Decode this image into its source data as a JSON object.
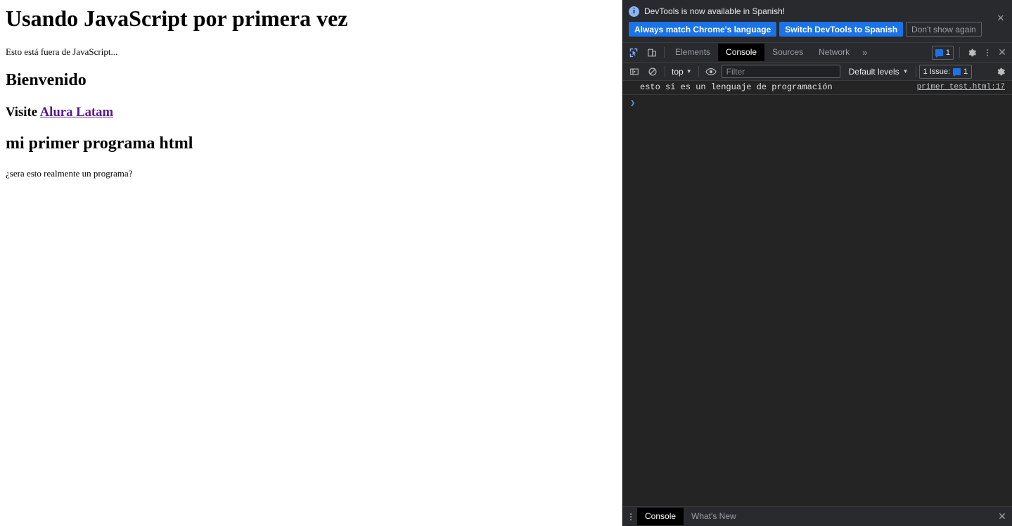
{
  "webpage": {
    "title_h1": "Usando JavaScript por primera vez",
    "paragraph_1": "Esto está fuera de JavaScript...",
    "heading_bienvenido": "Bienvenido",
    "visit_prefix": "Visite ",
    "link_label": "Alura Latam",
    "link_color": "#551a8b",
    "heading_programa": "mi primer programa html",
    "paragraph_2": "¿sera esto realmente un programa?"
  },
  "devtools": {
    "banner": {
      "info_icon": "info-icon",
      "message": "DevTools is now available in Spanish!",
      "primary_button_1": "Always match Chrome's language",
      "primary_button_2": "Switch DevTools to Spanish",
      "secondary_button": "Don't show again",
      "close_label": "✕",
      "accent_color": "#1a73e8"
    },
    "tabbar": {
      "inspect_icon": "inspect-element-icon",
      "device_icon": "device-toolbar-icon",
      "tabs": [
        {
          "label": "Elements",
          "active": false
        },
        {
          "label": "Console",
          "active": true
        },
        {
          "label": "Sources",
          "active": false
        },
        {
          "label": "Network",
          "active": false
        }
      ],
      "more_tabs": "»",
      "issues_count": "1",
      "settings_icon": "gear-icon",
      "kebab_icon": "more-options-icon",
      "close_icon": "close-icon"
    },
    "consolebar": {
      "sidebar_icon": "console-sidebar-icon",
      "clear_icon": "clear-console-icon",
      "context": "top",
      "eye_icon": "live-expression-icon",
      "filter_placeholder": "Filter",
      "filter_value": "",
      "levels": "Default levels",
      "issues_label": "1 Issue:",
      "issues_count": "1",
      "settings_icon": "console-settings-icon"
    },
    "console": {
      "messages": [
        {
          "text": "esto si es un lenguaje de programación",
          "source": "primer test.html:17"
        }
      ],
      "prompt_arrow": "❯",
      "prompt_value": ""
    },
    "drawer": {
      "kebab_icon": "drawer-more-options-icon",
      "tabs": [
        {
          "label": "Console",
          "active": true
        },
        {
          "label": "What's New",
          "active": false
        }
      ],
      "close_icon": "close-drawer-icon"
    }
  }
}
